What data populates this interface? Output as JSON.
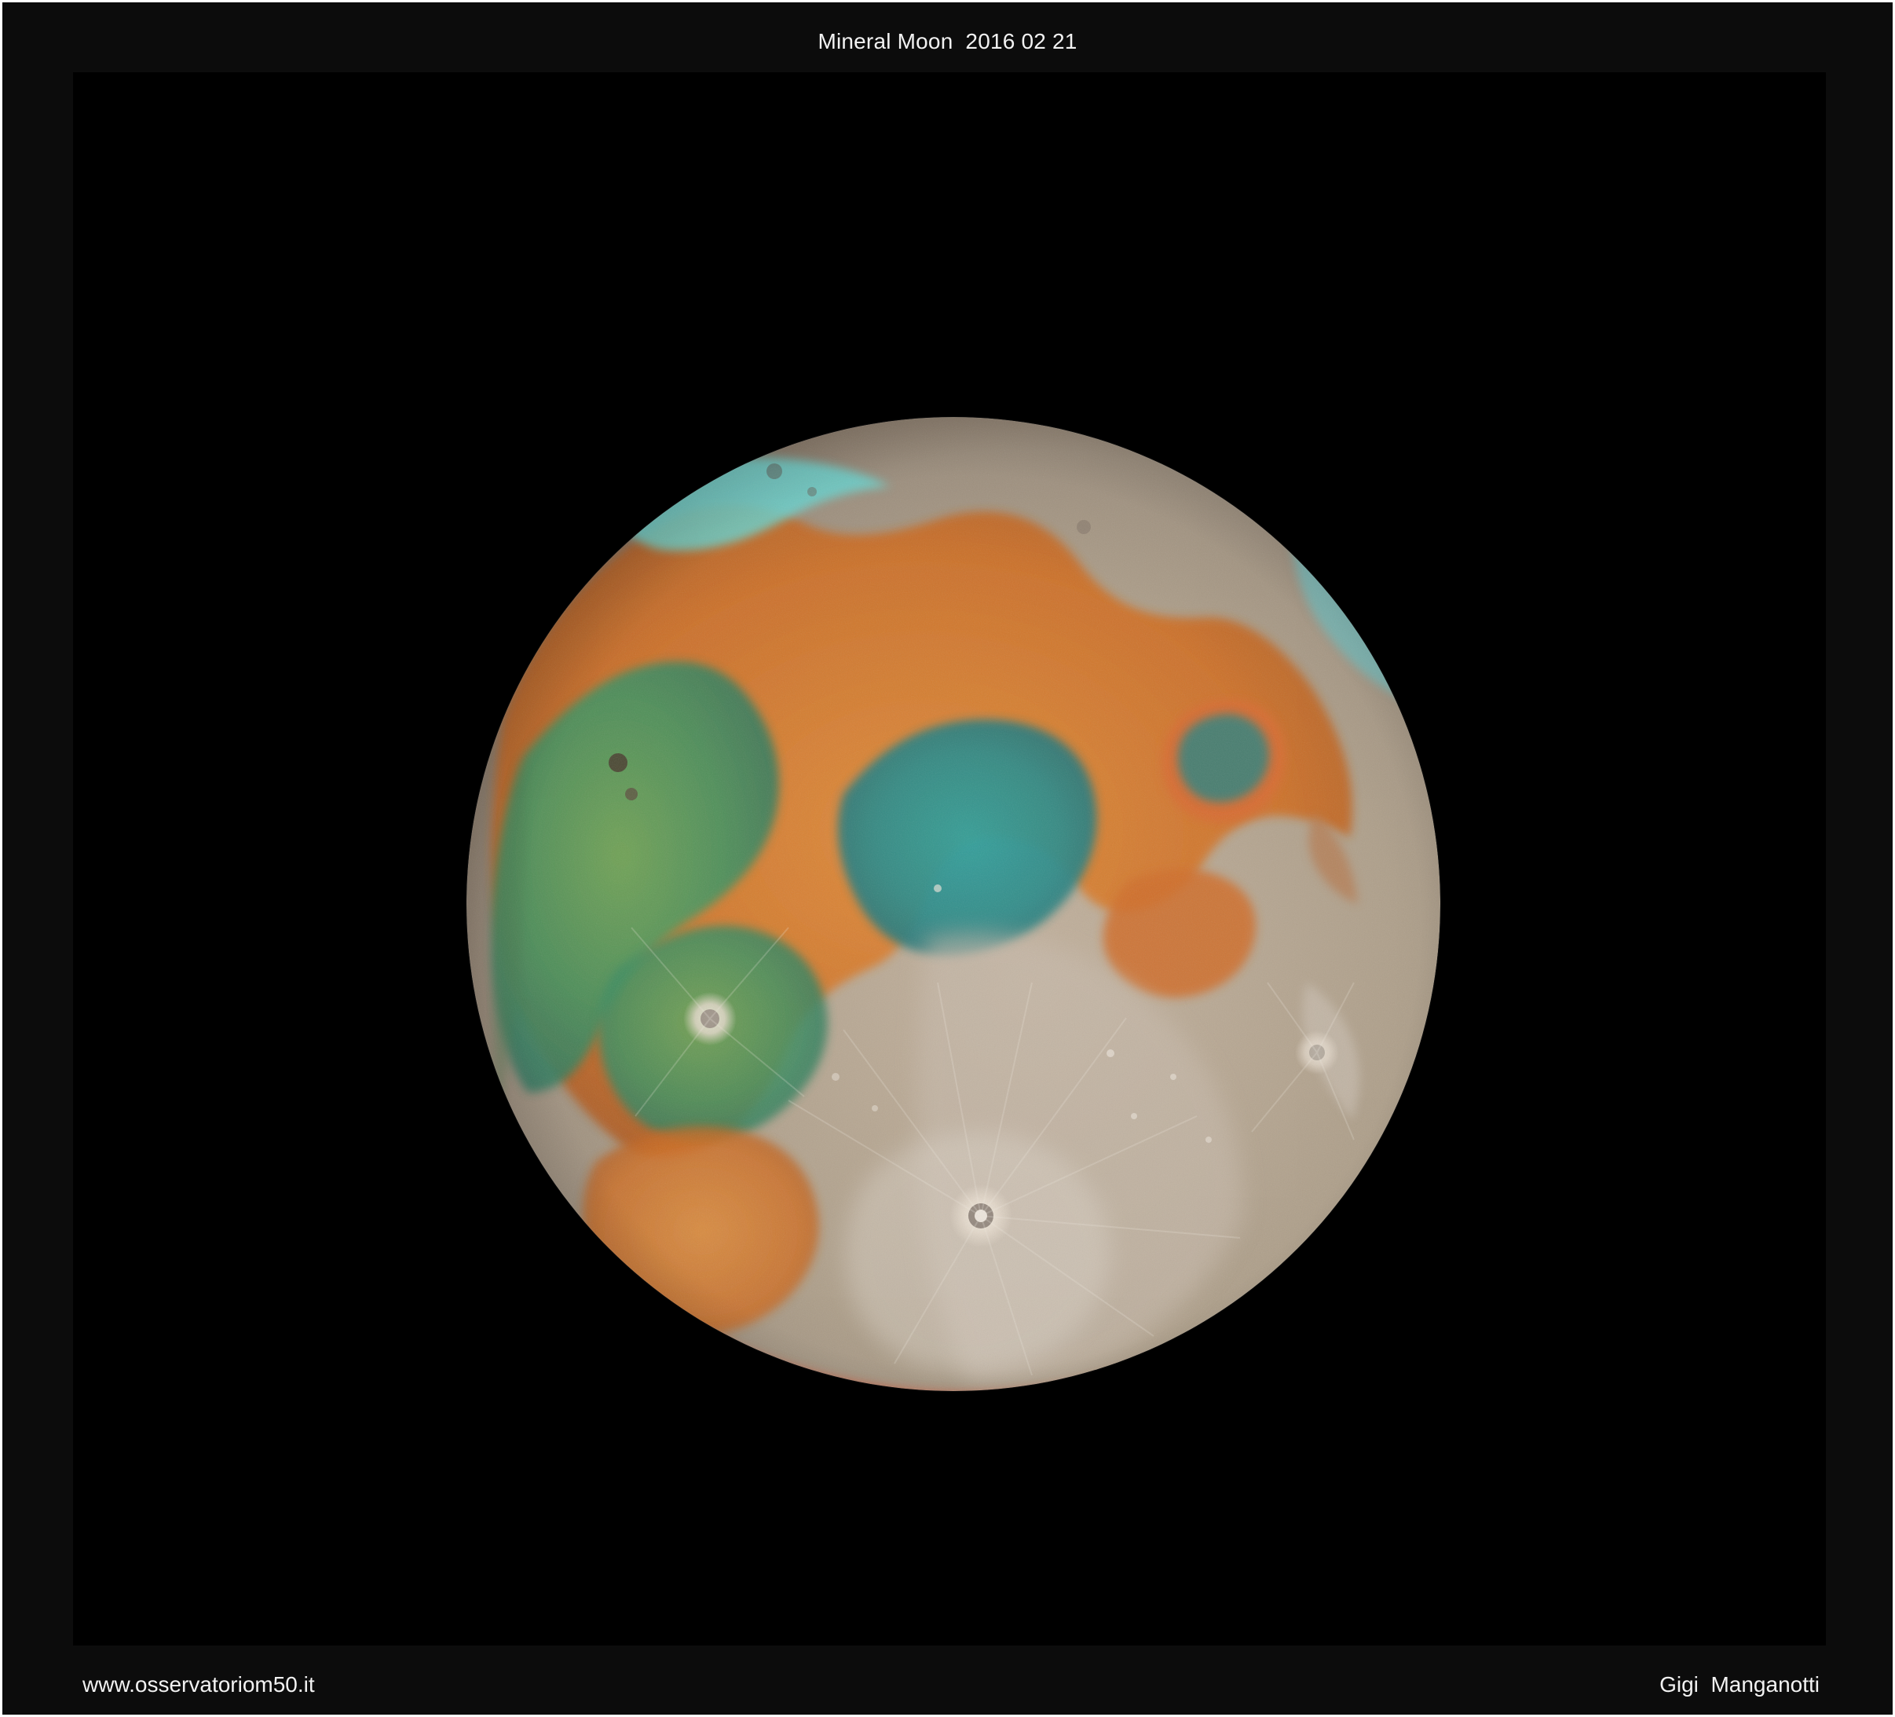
{
  "header": {
    "title": "Mineral Moon  2016 02 21"
  },
  "footer": {
    "website": "www.osservatoriom50.it",
    "author": "Gigi  Manganotti"
  },
  "image": {
    "subject_icon": "moon-photo",
    "background_color": "#000000",
    "frame_color": "#0c0c0c",
    "text_color": "#f2f2f2",
    "moon_colors": {
      "highland_gray": "#b8aa97",
      "orange_mare": "#d7792b",
      "teal_mare": "#2f8f86",
      "green_mare": "#4f9b58",
      "rim_cyan": "#63d8d4",
      "rim_red": "#dc4a2e"
    }
  }
}
